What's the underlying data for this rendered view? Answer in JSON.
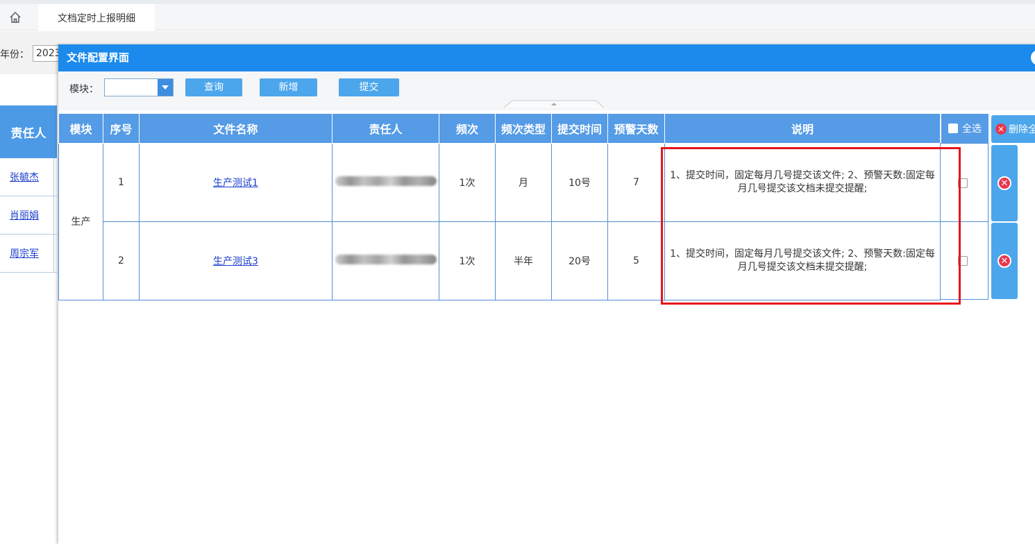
{
  "tabs": {
    "home_icon": "home-icon",
    "active_tab": "文档定时上报明细"
  },
  "filter": {
    "year_label": "年份：",
    "year_value": "2023"
  },
  "bg_table": {
    "header": "责任人",
    "rows": [
      "张毓杰",
      "肖丽娟",
      "周宗军"
    ]
  },
  "dialog": {
    "title": "文件配置界面",
    "close_icon": "close-icon",
    "toolbar": {
      "module_label": "模块：",
      "module_value": "",
      "query": "查询",
      "add": "新增",
      "submit": "提交"
    },
    "columns": [
      "模块",
      "序号",
      "文件名称",
      "责任人",
      "频次",
      "频次类型",
      "提交时间",
      "预警天数",
      "说明"
    ],
    "select_all": "全选",
    "delete_all": "删除全",
    "module_group": "生产",
    "rows": [
      {
        "seq": "1",
        "file": "生产测试1",
        "frequency": "1次",
        "freq_type": "月",
        "submit_time": "10号",
        "warn_days": "7",
        "desc": "1、提交时间，固定每月几号提交该文件; 2、预警天数:固定每月几号提交该文档未提交提醒;"
      },
      {
        "seq": "2",
        "file": "生产测试3",
        "frequency": "1次",
        "freq_type": "半年",
        "submit_time": "20号",
        "warn_days": "5",
        "desc": "1、提交时间，固定每月几号提交该文件; 2、预警天数:固定每月几号提交该文档未提交提醒;"
      }
    ]
  },
  "colors": {
    "title_bar": "#1b8aec",
    "header": "#559be6",
    "button": "#4ca6ec",
    "highlight": "#e8141c"
  }
}
